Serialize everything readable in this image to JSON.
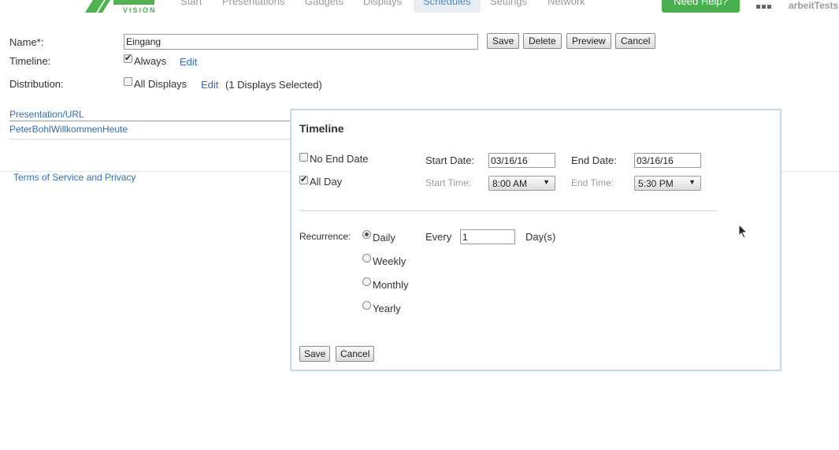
{
  "header": {
    "logo_text": "VISION",
    "nav": [
      "Start",
      "Presentations",
      "Gadgets",
      "Displays",
      "Schedules",
      "Settings",
      "Network"
    ],
    "help_label": "Need Help?",
    "user": "arbeitTests"
  },
  "form": {
    "name_label": "Name*:",
    "name_value": "Eingang",
    "save_label": "Save",
    "delete_label": "Delete",
    "preview_label": "Preview",
    "cancel_label": "Cancel",
    "timeline_label": "Timeline:",
    "always_label": "Always",
    "always_checked": true,
    "timeline_edit": "Edit",
    "distribution_label": "Distribution:",
    "all_displays_label": "All Displays",
    "all_displays_checked": false,
    "distribution_edit": "Edit",
    "displays_selected": "(1 Displays Selected)"
  },
  "list": {
    "header": "Presentation/URL",
    "items": [
      "PeterBohlWillkommenHeute"
    ]
  },
  "footer": {
    "terms_link": "Terms of Service and Privacy"
  },
  "timeline_dialog": {
    "title": "Timeline",
    "no_end_date_label": "No End Date",
    "no_end_date_checked": false,
    "all_day_label": "All Day",
    "all_day_checked": true,
    "start_date_label": "Start Date:",
    "start_date": "03/16/16",
    "end_date_label": "End Date:",
    "end_date": "03/16/16",
    "start_time_label": "Start Time:",
    "start_time": "8:00 AM",
    "end_time_label": "End Time:",
    "end_time": "5:30 PM",
    "recurrence_label": "Recurrence:",
    "recurrence_options": [
      "Daily",
      "Weekly",
      "Monthly",
      "Yearly"
    ],
    "recurrence_selected": "Daily",
    "every_label": "Every",
    "every_value": "1",
    "every_unit": "Day(s)",
    "save_label": "Save",
    "cancel_label": "Cancel"
  },
  "colors": {
    "accent": "#2f6db5",
    "help_button": "#49b04e",
    "dialog_border": "#c4d8ee"
  }
}
